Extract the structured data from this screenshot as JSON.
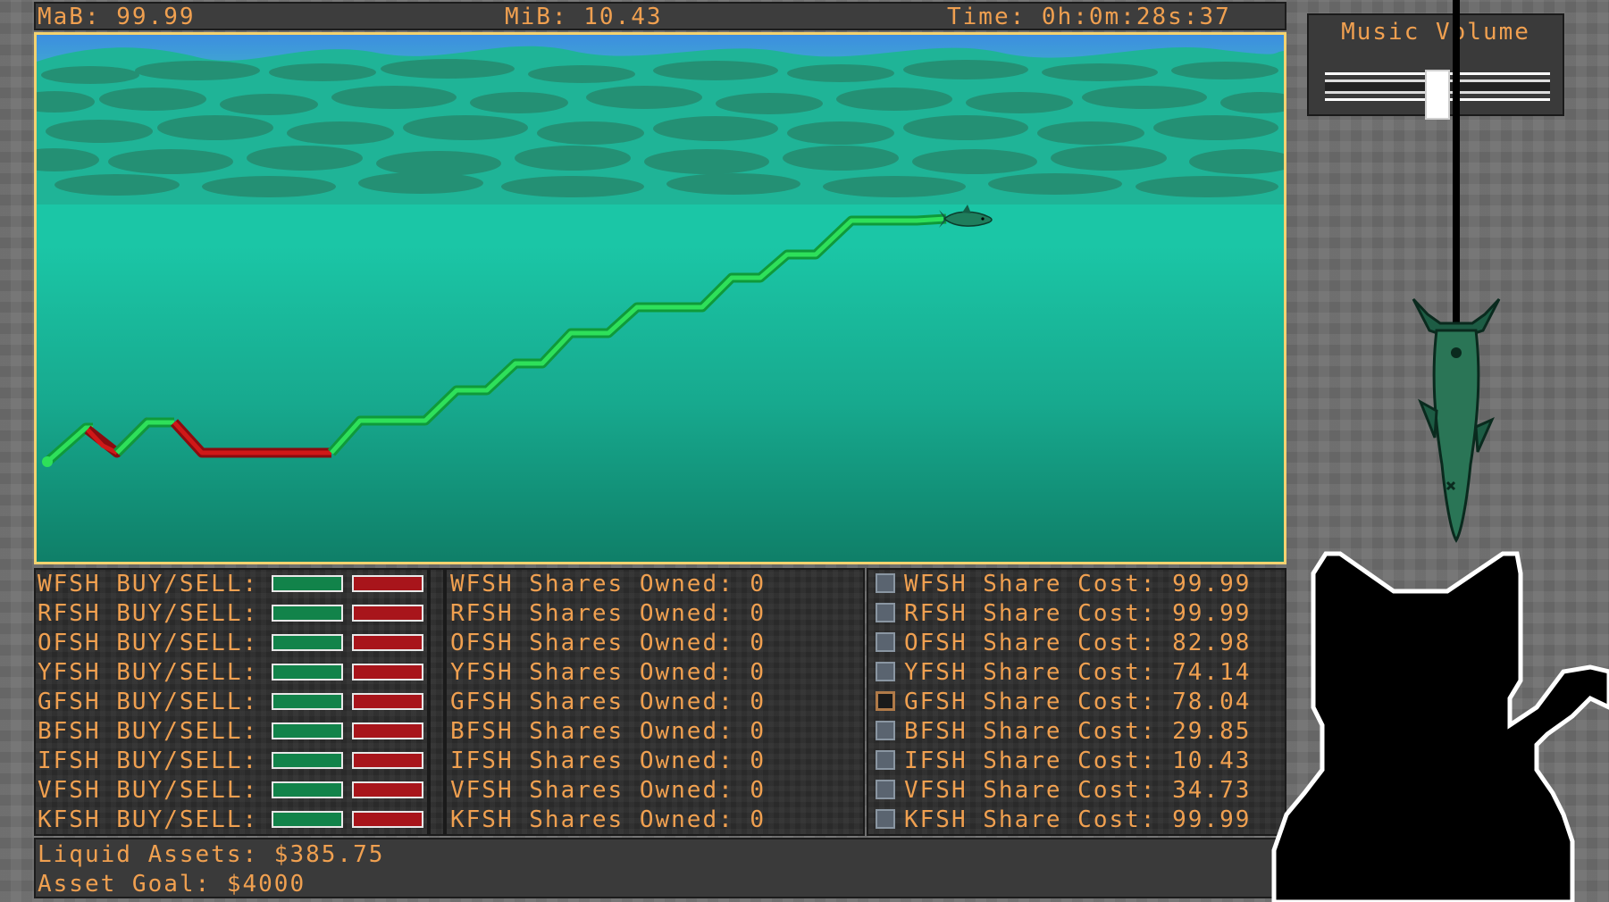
{
  "hud": {
    "mab": "MaB: 99.99",
    "mib": "MiB: 10.43",
    "time": "Time: 0h:0m:28s:37"
  },
  "music": {
    "title": "Music Volume",
    "volume_fraction": 0.5
  },
  "tickers": [
    {
      "buysell": "WFSH BUY/SELL:",
      "owned": "WFSH Shares Owned: 0",
      "cost": "WFSH Share Cost: 99.99",
      "selected": false
    },
    {
      "buysell": "RFSH BUY/SELL:",
      "owned": "RFSH Shares Owned: 0",
      "cost": "RFSH Share Cost: 99.99",
      "selected": false
    },
    {
      "buysell": "OFSH BUY/SELL:",
      "owned": "OFSH Shares Owned: 0",
      "cost": "OFSH Share Cost: 82.98",
      "selected": false
    },
    {
      "buysell": "YFSH BUY/SELL:",
      "owned": "YFSH Shares Owned: 0",
      "cost": "YFSH Share Cost: 74.14",
      "selected": false
    },
    {
      "buysell": "GFSH BUY/SELL:",
      "owned": "GFSH Shares Owned: 0",
      "cost": "GFSH Share Cost: 78.04",
      "selected": true
    },
    {
      "buysell": "BFSH BUY/SELL:",
      "owned": "BFSH Shares Owned: 0",
      "cost": "BFSH Share Cost: 29.85",
      "selected": false
    },
    {
      "buysell": "IFSH BUY/SELL:",
      "owned": "IFSH Shares Owned: 0",
      "cost": "IFSH Share Cost: 10.43",
      "selected": false
    },
    {
      "buysell": "VFSH BUY/SELL:",
      "owned": "VFSH Shares Owned: 0",
      "cost": "VFSH Share Cost: 34.73",
      "selected": false
    },
    {
      "buysell": "KFSH BUY/SELL:",
      "owned": "KFSH Shares Owned: 0",
      "cost": "KFSH Share Cost: 99.99",
      "selected": false
    }
  ],
  "assets": {
    "liquid": "Liquid Assets: $385.75",
    "goal": "Asset Goal: $4000"
  },
  "colors": {
    "accent_text": "#f0a050",
    "up_line": "#2ee05a",
    "down_line": "#d01818",
    "water": "#1cc8a8",
    "viewport_border": "#f3d270"
  },
  "icons": {
    "fish_cursor": "fish-icon",
    "hanging_fish": "hanging-fish-icon",
    "cat": "cat-silhouette"
  }
}
